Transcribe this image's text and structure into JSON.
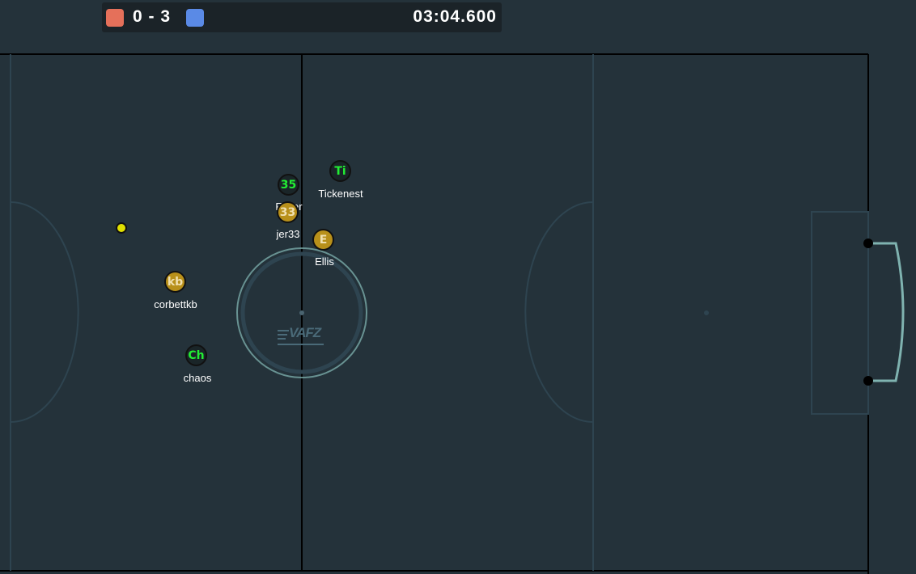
{
  "scoreboard": {
    "score_text": "0 - 3",
    "red_score": 0,
    "blue_score": 3,
    "timer": "03:04.600",
    "red_color": "#e5705a",
    "blue_color": "#5a8ae6"
  },
  "field": {
    "watermark": "VAFZ",
    "line_color": "#000000",
    "goal_color": "#7fb3b0"
  },
  "players": [
    {
      "label": "35",
      "name": "Faker",
      "team": "green",
      "text_color": "#22ee33"
    },
    {
      "label": "Ti",
      "name": "Tickenest",
      "team": "green",
      "text_color": "#22ee33"
    },
    {
      "label": "33",
      "name": "jer33",
      "team": "gold",
      "text_color": "#f0e0b0"
    },
    {
      "label": "E",
      "name": "Ellis",
      "team": "gold",
      "text_color": "#f0e0b0"
    },
    {
      "label": "kb",
      "name": "corbettkb",
      "team": "gold",
      "text_color": "#f0e0b0"
    },
    {
      "label": "Ch",
      "name": "chaos",
      "team": "green",
      "text_color": "#22ee33"
    }
  ]
}
